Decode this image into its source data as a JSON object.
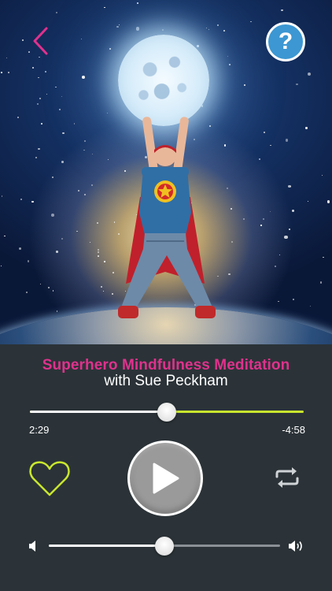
{
  "hero": {
    "artwork_description": "superhero-kid-holding-moon",
    "back_icon": "chevron-left-icon",
    "help_label": "?",
    "accent_color": "#e1318d"
  },
  "player": {
    "title": "Superhero Mindfulness Meditation",
    "subtitle": "with Sue Peckham",
    "elapsed": "2:29",
    "remaining": "-4:58",
    "progress_fraction": 0.5,
    "volume_fraction": 0.5,
    "favorite_icon": "heart-outline-icon",
    "play_icon": "play-icon",
    "repeat_icon": "repeat-icon",
    "volume_low_icon": "speaker-low-icon",
    "volume_high_icon": "speaker-high-icon",
    "colors": {
      "title": "#e1318d",
      "progress_remaining": "#c8e62e",
      "heart": "#c8e62e",
      "background": "#2b3338"
    }
  }
}
